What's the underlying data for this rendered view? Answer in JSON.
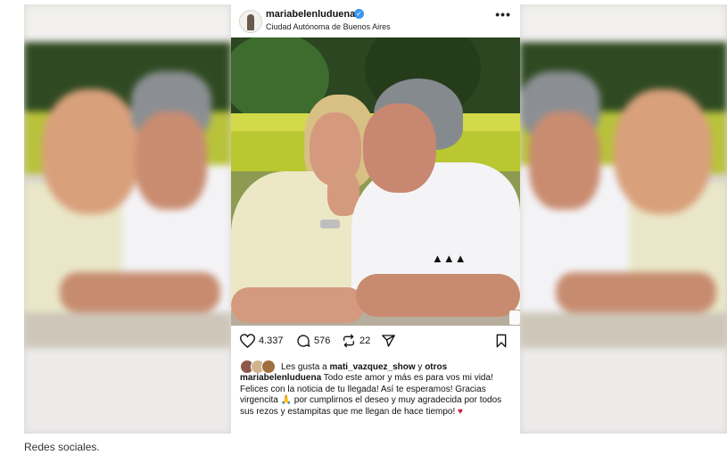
{
  "post": {
    "username": "mariabelenluduena",
    "location": "Ciudad Autónoma de Buenos Aires",
    "more_icon": "•••",
    "likes_count": "4.337",
    "comments_count": "576",
    "reposts_count": "22",
    "liked_by_prefix": "Les gusta a ",
    "liked_by_user": "mati_vazquez_show",
    "liked_by_suffix": " y ",
    "liked_by_others": "otros",
    "caption_author": "mariabelenluduena",
    "caption_text": " Todo este amor y más  es para vos mi vida! Felices con la noticia de tu llegada! Así te esperamos! Gracias virgencita 🙏 por cumplirnos el deseo y muy agradecida por todos sus rezos y estampitas que me llegan de hace tiempo! ",
    "caption_emoji": "♥"
  },
  "icons": {
    "like": "heart-icon",
    "comment": "comment-icon",
    "repost": "repost-icon",
    "share": "share-icon",
    "save": "bookmark-icon",
    "verified": "verified-badge-icon"
  },
  "colors": {
    "verified": "#3897f0",
    "heart_emoji": "#d0173b"
  },
  "footer": {
    "caption": "Redes sociales."
  }
}
